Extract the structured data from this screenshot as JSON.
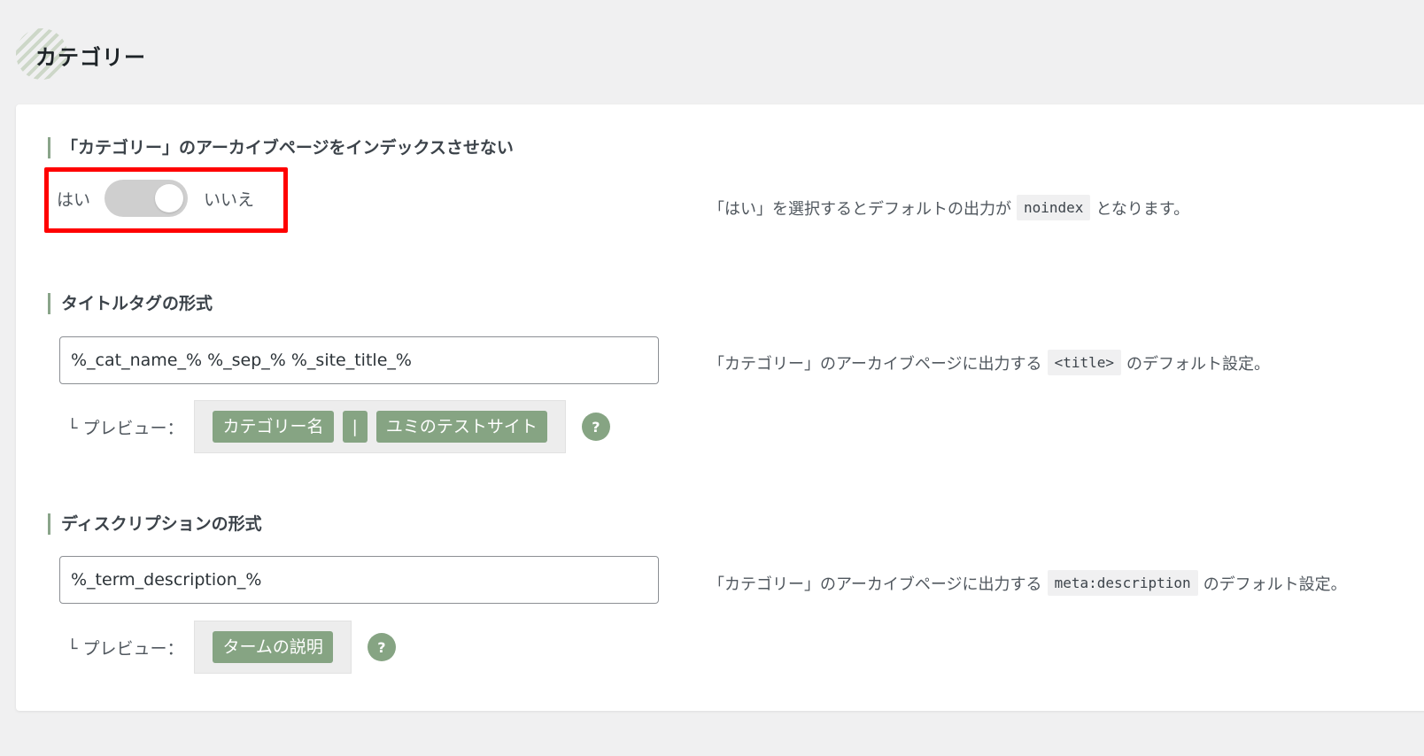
{
  "page": {
    "title": "カテゴリー"
  },
  "sections": {
    "noindex": {
      "heading": "「カテゴリー」のアーカイブページをインデックスさせない",
      "toggle": {
        "yes_label": "はい",
        "no_label": "いいえ",
        "state": "いいえ"
      },
      "help_prefix": "「はい」を選択するとデフォルトの出力が",
      "help_code": "noindex",
      "help_suffix": "となります。"
    },
    "title_format": {
      "heading": "タイトルタグの形式",
      "input_value": "%_cat_name_% %_sep_% %_site_title_%",
      "preview_label": "└ プレビュー：",
      "preview_chips": [
        "カテゴリー名",
        "|",
        "ユミのテストサイト"
      ],
      "help_icon_label": "?",
      "help_prefix": "「カテゴリー」のアーカイブページに出力する",
      "help_code": "<title>",
      "help_suffix": "のデフォルト設定。"
    },
    "description_format": {
      "heading": "ディスクリプションの形式",
      "input_value": "%_term_description_%",
      "preview_label": "└ プレビュー：",
      "preview_chips": [
        "タームの説明"
      ],
      "help_icon_label": "?",
      "help_prefix": "「カテゴリー」のアーカイブページに出力する",
      "help_code": "meta:description",
      "help_suffix": "のデフォルト設定。"
    }
  },
  "colors": {
    "accent": "#86a483",
    "highlight": "#ff0000",
    "toggle_track": "#cfcfcf"
  },
  "icons": {
    "help": "question-mark-circle-icon",
    "heading_deco": "striped-circle-icon"
  }
}
